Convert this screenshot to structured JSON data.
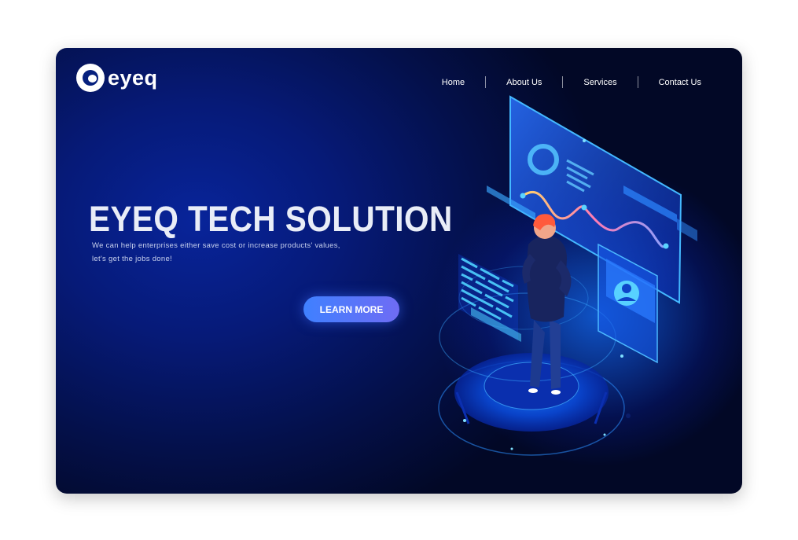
{
  "brand": {
    "name": "eyeq",
    "logo_icon": "eyeq-logo-icon"
  },
  "nav": {
    "items": [
      {
        "label": "Home"
      },
      {
        "label": "About Us"
      },
      {
        "label": "Services"
      },
      {
        "label": "Contact Us"
      }
    ]
  },
  "hero": {
    "title": "EYEQ TECH SOLUTION",
    "description": "We can help enterprises either save cost or increase products' values, let's get the jobs done!",
    "cta_label": "LEARN MORE"
  },
  "colors": {
    "background_dark": "#030a2c",
    "background_blue": "#061a78",
    "accent_cyan": "#2fd4ff",
    "cta_start": "#3f80ff",
    "cta_end": "#6f6cf4"
  },
  "illustration": {
    "icon": "isometric-tech-person-illustration"
  }
}
